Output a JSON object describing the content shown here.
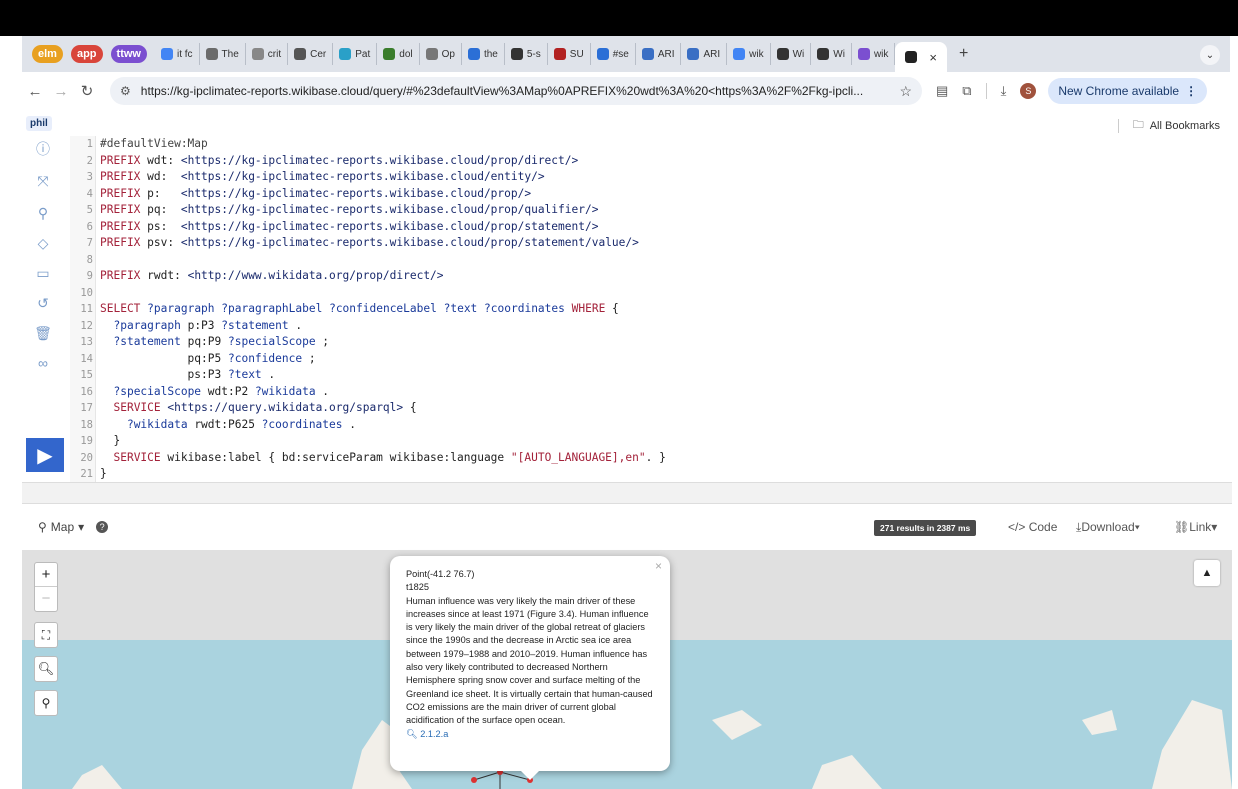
{
  "tabs": {
    "pills": [
      {
        "label": "elm",
        "color": "#e8a020"
      },
      {
        "label": "app",
        "color": "#d9453a"
      },
      {
        "label": "ttww",
        "color": "#7b4fd0"
      }
    ],
    "items": [
      {
        "label": "it fc",
        "color": "#4285f4"
      },
      {
        "label": "The",
        "color": "#6b6b6b"
      },
      {
        "label": "crit",
        "color": "#888888"
      },
      {
        "label": "Cer",
        "color": "#555555"
      },
      {
        "label": "Pat",
        "color": "#2aa0c8"
      },
      {
        "label": "dol",
        "color": "#3a7d2c"
      },
      {
        "label": "Op",
        "color": "#777777"
      },
      {
        "label": "the",
        "color": "#2b6fd6"
      },
      {
        "label": "5-s",
        "color": "#333333"
      },
      {
        "label": "SU",
        "color": "#b22222"
      },
      {
        "label": "#se",
        "color": "#2b6fd6"
      },
      {
        "label": "ARI",
        "color": "#3a6fc4"
      },
      {
        "label": "ARI",
        "color": "#3a6fc4"
      },
      {
        "label": "wik",
        "color": "#4285f4"
      },
      {
        "label": "Wi",
        "color": "#333333"
      },
      {
        "label": "Wi",
        "color": "#333333"
      },
      {
        "label": "wik",
        "color": "#7b4fd0"
      }
    ],
    "active_close": "×",
    "new_tab": "+",
    "dropdown": "⌄"
  },
  "address": {
    "url": "https://kg-ipclimatec-reports.wikibase.cloud/query/#%23defaultView%3AMap%0APREFIX%20wdt%3A%20<https%3A%2F%2Fkg-ipcli...",
    "new_chrome": "New Chrome available",
    "avatar_letter": "S"
  },
  "bookmarks": {
    "first": "phil",
    "all": "All Bookmarks"
  },
  "editor": {
    "lines": [
      {
        "n": "1",
        "t": "#defaultView:Map"
      },
      {
        "n": "2",
        "t": "PREFIX wdt: <https://kg-ipclimatec-reports.wikibase.cloud/prop/direct/>"
      },
      {
        "n": "3",
        "t": "PREFIX wd:  <https://kg-ipclimatec-reports.wikibase.cloud/entity/>"
      },
      {
        "n": "4",
        "t": "PREFIX p:   <https://kg-ipclimatec-reports.wikibase.cloud/prop/>"
      },
      {
        "n": "5",
        "t": "PREFIX pq:  <https://kg-ipclimatec-reports.wikibase.cloud/prop/qualifier/>"
      },
      {
        "n": "6",
        "t": "PREFIX ps:  <https://kg-ipclimatec-reports.wikibase.cloud/prop/statement/>"
      },
      {
        "n": "7",
        "t": "PREFIX psv: <https://kg-ipclimatec-reports.wikibase.cloud/prop/statement/value/>"
      },
      {
        "n": "8",
        "t": ""
      },
      {
        "n": "9",
        "t": "PREFIX rwdt: <http://www.wikidata.org/prop/direct/>"
      },
      {
        "n": "10",
        "t": ""
      },
      {
        "n": "11",
        "t": "SELECT ?paragraph ?paragraphLabel ?confidenceLabel ?text ?coordinates WHERE {"
      },
      {
        "n": "12",
        "t": "  ?paragraph p:P3 ?statement ."
      },
      {
        "n": "13",
        "t": "  ?statement pq:P9 ?specialScope ;"
      },
      {
        "n": "14",
        "t": "             pq:P5 ?confidence ;"
      },
      {
        "n": "15",
        "t": "             ps:P3 ?text ."
      },
      {
        "n": "16",
        "t": "  ?specialScope wdt:P2 ?wikidata ."
      },
      {
        "n": "17",
        "t": "  SERVICE <https://query.wikidata.org/sparql> {"
      },
      {
        "n": "18",
        "t": "    ?wikidata rwdt:P625 ?coordinates ."
      },
      {
        "n": "19",
        "t": "  }"
      },
      {
        "n": "20",
        "t": "  SERVICE wikibase:label { bd:serviceParam wikibase:language \"[AUTO_LANGUAGE],en\". }"
      },
      {
        "n": "21",
        "t": "}"
      }
    ]
  },
  "results": {
    "view": "Map",
    "count": "271 results in 2387 ms",
    "code": "Code",
    "download": "Download",
    "link": "Link"
  },
  "popup": {
    "point": "Point(-41.2 76.7)",
    "id": "t1825",
    "text": "Human influence was very likely the main driver of these increases since at least 1971 (Figure 3.4). Human influence is very likely the main driver of the global retreat of glaciers since the 1990s and the decrease in Arctic sea ice area between 1979–1988 and 2010–2019. Human influence has also very likely contributed to decreased Northern Hemisphere spring snow cover and surface melting of the Greenland ice sheet. It is virtually certain that human-caused CO2 emissions are the main driver of current global acidification of the surface open ocean.",
    "link": "2.1.2.a",
    "close": "×"
  }
}
